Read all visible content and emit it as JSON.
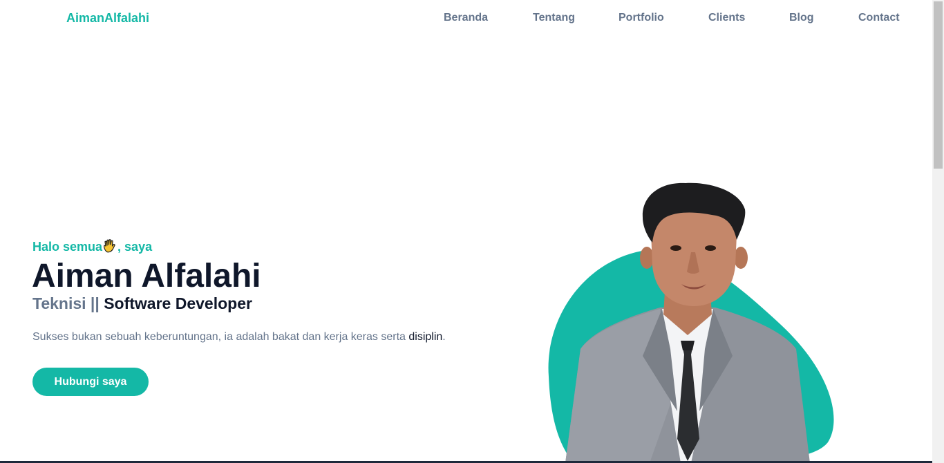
{
  "header": {
    "brand": "AimanAlfalahi",
    "nav": [
      {
        "label": "Beranda"
      },
      {
        "label": "Tentang"
      },
      {
        "label": "Portfolio"
      },
      {
        "label": "Clients"
      },
      {
        "label": "Blog"
      },
      {
        "label": "Contact"
      }
    ]
  },
  "hero": {
    "greeting_prefix": "Halo semua",
    "greeting_suffix": ", saya",
    "name": "Aiman Alfalahi",
    "role_prefix": "Teknisi ||",
    "role_main": "Software Developer",
    "tagline_prefix": "Sukses bukan sebuah keberuntungan, ia adalah bakat dan kerja keras serta ",
    "tagline_highlight": "disiplin",
    "tagline_suffix": ".",
    "cta_label": "Hubungi saya"
  },
  "colors": {
    "accent": "#14b8a6",
    "heading": "#0f172a",
    "muted": "#64748b"
  },
  "icons": {
    "greeting_icon": "waving-hand-icon"
  }
}
